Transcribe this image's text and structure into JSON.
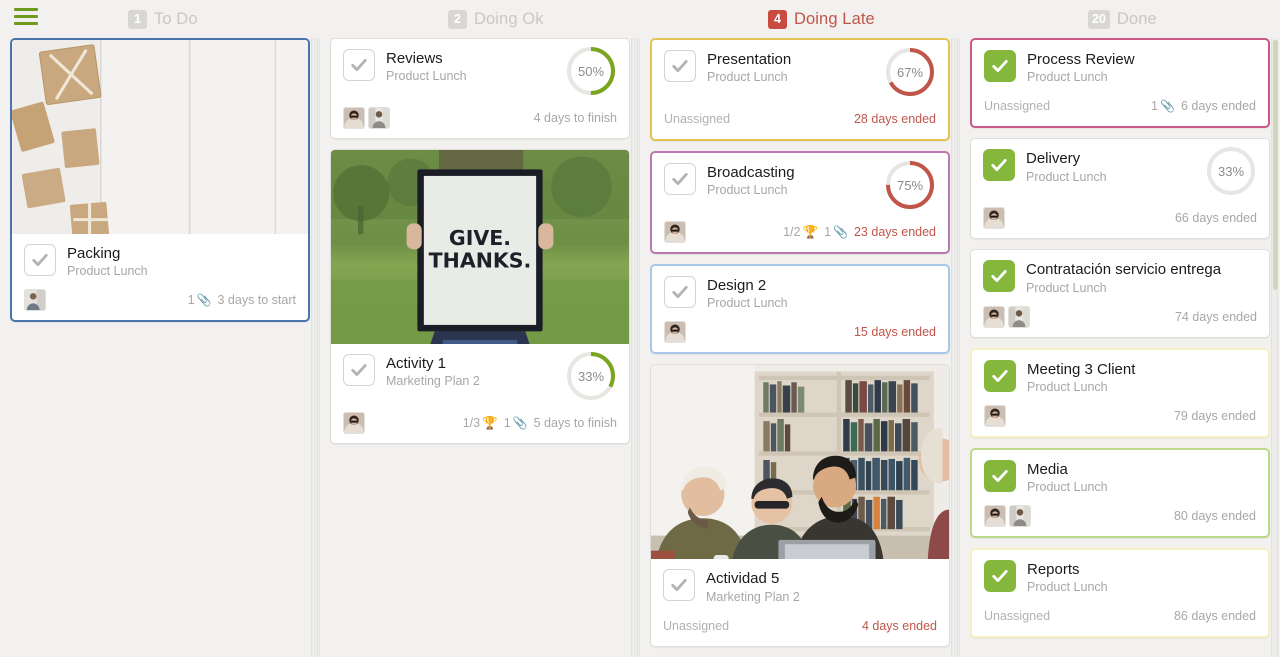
{
  "app": {
    "menu_icon": "hamburger-menu-icon",
    "accent_green": "#6f9a1e",
    "late_red": "#c0564a",
    "done_green": "#85b73c"
  },
  "columns": [
    {
      "id": "todo",
      "count": "1",
      "title": "To Do",
      "late": false,
      "cards": [
        {
          "id": "packing",
          "border": "b-blue",
          "photo": "packages-on-white-wood",
          "photo_alt": "Brown cardboard parcels on white wooden planks",
          "title": "Packing",
          "subtitle": "Product Lunch",
          "checked": false,
          "progress": null,
          "progress_color": null,
          "avatars": [
            "avatar-person-1"
          ],
          "unassigned": null,
          "checklist": null,
          "attachments": "1",
          "days": "3 days to start",
          "days_late": false
        }
      ]
    },
    {
      "id": "doing-ok",
      "count": "2",
      "title": "Doing Ok",
      "late": false,
      "cards": [
        {
          "id": "reviews",
          "border": "",
          "photo": null,
          "photo_alt": null,
          "title": "Reviews",
          "subtitle": "Product Lunch",
          "checked": false,
          "progress": 50,
          "progress_label": "50%",
          "progress_color": "#7ba520",
          "avatars": [
            "avatar-person-2",
            "avatar-person-3"
          ],
          "unassigned": null,
          "checklist": null,
          "attachments": null,
          "days": "4 days to finish",
          "days_late": false
        },
        {
          "id": "activity-1",
          "border": "",
          "photo": "give-thanks-sign",
          "photo_alt": "Person holding a framed GIVE. THANKS. sign in a green field",
          "title": "Activity 1",
          "subtitle": "Marketing Plan 2",
          "checked": false,
          "progress": 33,
          "progress_label": "33%",
          "progress_color": "#7ba520",
          "avatars": [
            "avatar-person-2"
          ],
          "unassigned": null,
          "checklist": "1/3",
          "attachments": "1",
          "days": "5 days to finish",
          "days_late": false
        }
      ]
    },
    {
      "id": "doing-late",
      "count": "4",
      "title": "Doing Late",
      "late": true,
      "cards": [
        {
          "id": "presentation",
          "border": "b-gold",
          "photo": null,
          "photo_alt": null,
          "title": "Presentation",
          "subtitle": "Product Lunch",
          "checked": false,
          "progress": 67,
          "progress_label": "67%",
          "progress_color": "#c0564a",
          "avatars": [],
          "unassigned": "Unassigned",
          "checklist": null,
          "attachments": null,
          "days": "28 days ended",
          "days_late": true
        },
        {
          "id": "broadcasting",
          "border": "b-purple",
          "photo": null,
          "photo_alt": null,
          "title": "Broadcasting",
          "subtitle": "Product Lunch",
          "checked": false,
          "progress": 75,
          "progress_label": "75%",
          "progress_color": "#c0564a",
          "avatars": [
            "avatar-person-2"
          ],
          "unassigned": null,
          "checklist": "1/2",
          "attachments": "1",
          "days": "23 days ended",
          "days_late": true
        },
        {
          "id": "design-2",
          "border": "b-lblue",
          "photo": null,
          "photo_alt": null,
          "title": "Design 2",
          "subtitle": "Product Lunch",
          "checked": false,
          "progress": null,
          "progress_color": null,
          "avatars": [
            "avatar-person-2"
          ],
          "unassigned": null,
          "checklist": null,
          "attachments": null,
          "days": "15 days ended",
          "days_late": true
        },
        {
          "id": "actividad-5",
          "border": "",
          "photo": "library-team-meeting",
          "photo_alt": "Group of people around a table in front of bookshelves",
          "title": "Actividad 5",
          "subtitle": "Marketing Plan 2",
          "checked": false,
          "progress": null,
          "progress_color": null,
          "avatars": [],
          "unassigned": "Unassigned",
          "checklist": null,
          "attachments": null,
          "days": "4 days ended",
          "days_late": true
        }
      ]
    },
    {
      "id": "done",
      "count": "20",
      "title": "Done",
      "late": false,
      "cards": [
        {
          "id": "process-review",
          "border": "b-pink",
          "photo": null,
          "photo_alt": null,
          "title": "Process Review",
          "subtitle": "Product Lunch",
          "checked": true,
          "progress": null,
          "progress_color": null,
          "avatars": [],
          "unassigned": "Unassigned",
          "checklist": null,
          "attachments": "1",
          "days": "6 days ended",
          "days_late": false
        },
        {
          "id": "delivery",
          "border": "",
          "photo": null,
          "photo_alt": null,
          "title": "Delivery",
          "subtitle": "Product Lunch",
          "checked": true,
          "progress": 0,
          "progress_label": "33%",
          "progress_color": "#e8e6e3",
          "avatars": [
            "avatar-person-2"
          ],
          "unassigned": null,
          "checklist": null,
          "attachments": null,
          "days": "66 days ended",
          "days_late": false
        },
        {
          "id": "contratacion-servicio-entrega",
          "border": "",
          "photo": null,
          "photo_alt": null,
          "title": "Contratación servicio entrega",
          "subtitle": "Product Lunch",
          "checked": true,
          "progress": null,
          "progress_color": null,
          "avatars": [
            "avatar-person-2",
            "avatar-person-3"
          ],
          "unassigned": null,
          "checklist": null,
          "attachments": null,
          "days": "74 days ended",
          "days_late": false
        },
        {
          "id": "meeting-3-client",
          "border": "b-cream",
          "photo": null,
          "photo_alt": null,
          "title": "Meeting 3 Client",
          "subtitle": "Product Lunch",
          "checked": true,
          "progress": null,
          "progress_color": null,
          "avatars": [
            "avatar-person-2"
          ],
          "unassigned": null,
          "checklist": null,
          "attachments": null,
          "days": "79 days ended",
          "days_late": false
        },
        {
          "id": "media",
          "border": "b-green",
          "photo": null,
          "photo_alt": null,
          "title": "Media",
          "subtitle": "Product Lunch",
          "checked": true,
          "progress": null,
          "progress_color": null,
          "avatars": [
            "avatar-person-2",
            "avatar-person-3"
          ],
          "unassigned": null,
          "checklist": null,
          "attachments": null,
          "days": "80 days ended",
          "days_late": false
        },
        {
          "id": "reports",
          "border": "b-cream",
          "photo": null,
          "photo_alt": null,
          "title": "Reports",
          "subtitle": "Product Lunch",
          "checked": true,
          "progress": null,
          "progress_color": null,
          "avatars": [],
          "unassigned": "Unassigned",
          "checklist": null,
          "attachments": null,
          "days": "86 days ended",
          "days_late": false
        }
      ]
    }
  ],
  "icons": {
    "attachment": "paperclip-icon",
    "checklist": "trophy-icon",
    "check": "checkmark-icon"
  }
}
